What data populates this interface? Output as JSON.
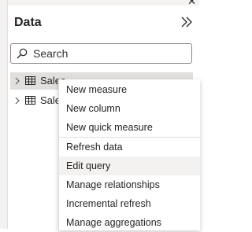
{
  "pane": {
    "title": "Data",
    "search_placeholder": "Search"
  },
  "tables": [
    {
      "name": "Sales",
      "selected": true
    },
    {
      "name": "Sales",
      "selected": false
    }
  ],
  "context_menu": {
    "items": [
      {
        "label": "New measure"
      },
      {
        "label": "New column"
      },
      {
        "label": "New quick measure"
      },
      {
        "label": "Refresh data"
      },
      {
        "label": "Edit query",
        "hovered": true
      },
      {
        "label": "Manage relationships"
      },
      {
        "label": "Incremental refresh"
      },
      {
        "label": "Manage aggregations"
      }
    ]
  },
  "colors": {
    "selection": "#e1dfdd",
    "hover": "#f3f2f1",
    "text": "#252423"
  }
}
